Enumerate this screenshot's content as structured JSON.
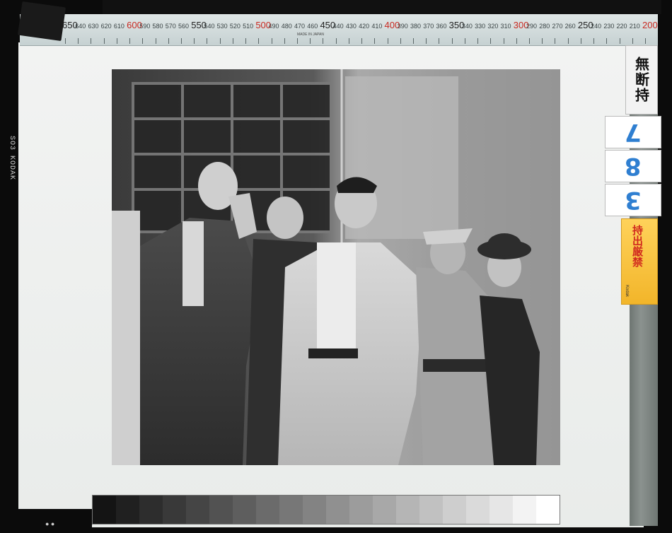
{
  "film_edge": {
    "code": "SO3 KODAK",
    "made_in": "MADE IN JAPAN"
  },
  "ruler": {
    "labels": [
      {
        "text": "650",
        "kind": "big",
        "pos": 0
      },
      {
        "text": "640",
        "kind": "small",
        "pos": 1
      },
      {
        "text": "630",
        "kind": "small",
        "pos": 2
      },
      {
        "text": "620",
        "kind": "small",
        "pos": 3
      },
      {
        "text": "610",
        "kind": "small",
        "pos": 4
      },
      {
        "text": "600",
        "kind": "red",
        "pos": 5
      },
      {
        "text": "590",
        "kind": "small",
        "pos": 6
      },
      {
        "text": "580",
        "kind": "small",
        "pos": 7
      },
      {
        "text": "570",
        "kind": "small",
        "pos": 8
      },
      {
        "text": "560",
        "kind": "small",
        "pos": 9
      },
      {
        "text": "550",
        "kind": "big",
        "pos": 10
      },
      {
        "text": "540",
        "kind": "small",
        "pos": 11
      },
      {
        "text": "530",
        "kind": "small",
        "pos": 12
      },
      {
        "text": "520",
        "kind": "small",
        "pos": 13
      },
      {
        "text": "510",
        "kind": "small",
        "pos": 14
      },
      {
        "text": "500",
        "kind": "red",
        "pos": 15
      },
      {
        "text": "490",
        "kind": "small",
        "pos": 16
      },
      {
        "text": "480",
        "kind": "small",
        "pos": 17
      },
      {
        "text": "470",
        "kind": "small",
        "pos": 18
      },
      {
        "text": "460",
        "kind": "small",
        "pos": 19
      },
      {
        "text": "450",
        "kind": "big",
        "pos": 20
      },
      {
        "text": "440",
        "kind": "small",
        "pos": 21
      },
      {
        "text": "430",
        "kind": "small",
        "pos": 22
      },
      {
        "text": "420",
        "kind": "small",
        "pos": 23
      },
      {
        "text": "410",
        "kind": "small",
        "pos": 24
      },
      {
        "text": "400",
        "kind": "red",
        "pos": 25
      },
      {
        "text": "390",
        "kind": "small",
        "pos": 26
      },
      {
        "text": "380",
        "kind": "small",
        "pos": 27
      },
      {
        "text": "370",
        "kind": "small",
        "pos": 28
      },
      {
        "text": "360",
        "kind": "small",
        "pos": 29
      },
      {
        "text": "350",
        "kind": "big",
        "pos": 30
      },
      {
        "text": "340",
        "kind": "small",
        "pos": 31
      },
      {
        "text": "330",
        "kind": "small",
        "pos": 32
      },
      {
        "text": "320",
        "kind": "small",
        "pos": 33
      },
      {
        "text": "310",
        "kind": "small",
        "pos": 34
      },
      {
        "text": "300",
        "kind": "red",
        "pos": 35
      },
      {
        "text": "290",
        "kind": "small",
        "pos": 36
      },
      {
        "text": "280",
        "kind": "small",
        "pos": 37
      },
      {
        "text": "270",
        "kind": "small",
        "pos": 38
      },
      {
        "text": "260",
        "kind": "small",
        "pos": 39
      },
      {
        "text": "250",
        "kind": "big",
        "pos": 40
      },
      {
        "text": "240",
        "kind": "small",
        "pos": 41
      },
      {
        "text": "230",
        "kind": "small",
        "pos": 42
      },
      {
        "text": "220",
        "kind": "small",
        "pos": 43
      },
      {
        "text": "210",
        "kind": "small",
        "pos": 44
      },
      {
        "text": "200",
        "kind": "red",
        "pos": 45
      }
    ]
  },
  "labels": {
    "kanji_tag": "無断持",
    "archive_digits": [
      "7",
      "8",
      "3"
    ],
    "orange_tag": "持出厳禁",
    "orange_small": "Kodak"
  },
  "photo": {
    "description_icon": "photo-image"
  },
  "colors": {
    "ruler_red": "#c92a22",
    "number_blue": "#2f7fd1",
    "orange_tag": "#f2b52a"
  }
}
